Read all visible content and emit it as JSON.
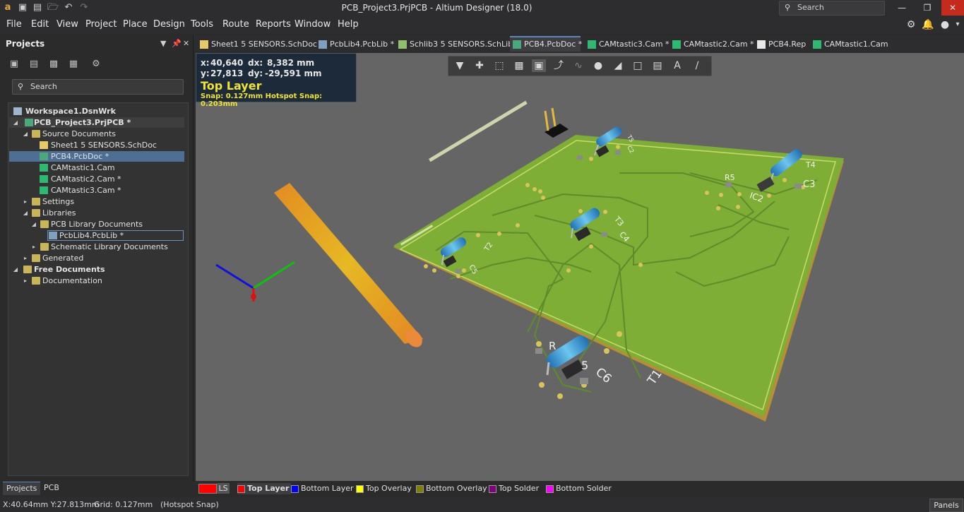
{
  "app": {
    "window_title": "PCB_Project3.PrjPCB - Altium Designer (18.0)",
    "search_placeholder": "Search"
  },
  "menu": [
    {
      "label": "File"
    },
    {
      "label": "Edit"
    },
    {
      "label": "View"
    },
    {
      "label": "Project"
    },
    {
      "label": "Place"
    },
    {
      "label": "Design"
    },
    {
      "label": "Tools"
    },
    {
      "label": "Route"
    },
    {
      "label": "Reports"
    },
    {
      "label": "Window"
    },
    {
      "label": "Help"
    }
  ],
  "projects_panel": {
    "title": "Projects",
    "search_placeholder": "Search",
    "tree": [
      {
        "label": "Workspace1.DsnWrk",
        "icon": "workspace-icon",
        "bold": true
      },
      {
        "label": "PCB_Project3.PrjPCB *",
        "icon": "pcb-project-icon",
        "bold": true
      },
      {
        "label": "Source Documents",
        "icon": "folder-icon"
      },
      {
        "label": "Sheet1 5 SENSORS.SchDoc",
        "icon": "schematic-doc-icon"
      },
      {
        "label": "PCB4.PcbDoc *",
        "icon": "pcb-doc-icon"
      },
      {
        "label": "CAMtastic1.Cam",
        "icon": "cam-icon"
      },
      {
        "label": "CAMtastic2.Cam *",
        "icon": "cam-icon"
      },
      {
        "label": "CAMtastic3.Cam *",
        "icon": "cam-icon"
      },
      {
        "label": "Settings",
        "icon": "folder-icon"
      },
      {
        "label": "Libraries",
        "icon": "folder-icon"
      },
      {
        "label": "PCB Library Documents",
        "icon": "folder-icon"
      },
      {
        "label": "PcbLib4.PcbLib *",
        "icon": "pcb-lib-icon"
      },
      {
        "label": "Schematic Library Documents",
        "icon": "folder-icon"
      },
      {
        "label": "Generated",
        "icon": "folder-icon"
      },
      {
        "label": "Free Documents",
        "icon": "folder-icon",
        "bold": true
      },
      {
        "label": "Documentation",
        "icon": "folder-icon"
      }
    ],
    "bottom_tabs": [
      "Projects",
      "PCB"
    ]
  },
  "doc_tabs": [
    {
      "label": "Sheet1 5 SENSORS.SchDoc",
      "icon": "schematic-doc-icon"
    },
    {
      "label": "PcbLib4.PcbLib *",
      "icon": "pcb-lib-icon"
    },
    {
      "label": "Schlib3 5 SENSORS.SchLib",
      "icon": "schematic-lib-icon"
    },
    {
      "label": "PCB4.PcbDoc *",
      "icon": "pcb-doc-icon",
      "active": true
    },
    {
      "label": "CAMtastic3.Cam *",
      "icon": "cam-icon"
    },
    {
      "label": "CAMtastic2.Cam *",
      "icon": "cam-icon"
    },
    {
      "label": "PCB4.Rep",
      "icon": "report-icon"
    },
    {
      "label": "CAMtastic1.Cam",
      "icon": "cam-icon"
    }
  ],
  "hud": {
    "x_label": "x:",
    "x_value": "40,640",
    "dx_label": "dx:",
    "dx_value": "8,382 mm",
    "y_label": "y:",
    "y_value": "27,813",
    "dy_label": "dy:",
    "dy_value": "-29,591 mm",
    "layer": "Top Layer",
    "snap": "Snap: 0.127mm Hotspot Snap: 0.203mm"
  },
  "pcb_labels": {
    "t1": "T1",
    "t2": "T2",
    "t3": "T3",
    "t4": "T4",
    "t5": "T5",
    "c2": "C2",
    "c3": "C3",
    "c4": "C4",
    "c5": "C5",
    "c6": "C6",
    "r5": "R5",
    "ic2": "IC2",
    "r": "R",
    "five": "5"
  },
  "layer_tabs": {
    "ls_label": "LS",
    "layers": [
      {
        "name": "Top Layer",
        "color": "#ff0000",
        "active": true
      },
      {
        "name": "Bottom Layer",
        "color": "#0000ff"
      },
      {
        "name": "Top Overlay",
        "color": "#ffff00"
      },
      {
        "name": "Bottom Overlay",
        "color": "#808000"
      },
      {
        "name": "Top Solder",
        "color": "#800080"
      },
      {
        "name": "Bottom Solder",
        "color": "#ff00ff"
      }
    ]
  },
  "status": {
    "coords": "X:40.64mm Y:27.813mm",
    "grid": "Grid: 0.127mm",
    "snap": "(Hotspot Snap)",
    "panels_button": "Panels"
  }
}
